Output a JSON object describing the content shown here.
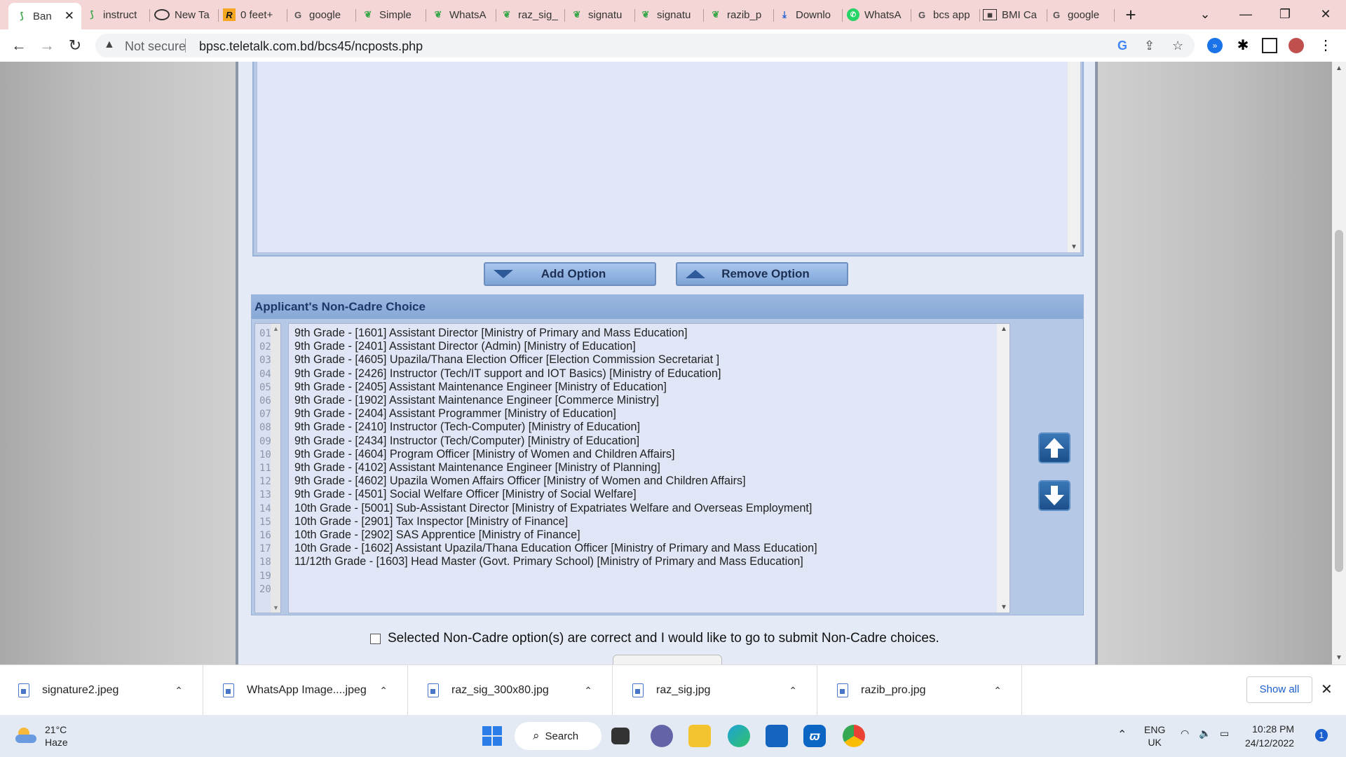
{
  "browser": {
    "tabs": [
      {
        "label": "Ban",
        "icon": "bpsc-leaf-icon",
        "active": true
      },
      {
        "label": "instruct",
        "icon": "bpsc-leaf-icon"
      },
      {
        "label": "New Ta",
        "icon": "chrome-icon"
      },
      {
        "label": "0 feet+",
        "icon": "r-logo-icon"
      },
      {
        "label": "google",
        "icon": "google-icon"
      },
      {
        "label": "Simple",
        "icon": "green-leaf-icon"
      },
      {
        "label": "WhatsA",
        "icon": "green-leaf-icon"
      },
      {
        "label": "raz_sig_",
        "icon": "green-leaf-icon"
      },
      {
        "label": "signatu",
        "icon": "green-leaf-icon"
      },
      {
        "label": "signatu",
        "icon": "green-leaf-icon"
      },
      {
        "label": "razib_p",
        "icon": "green-leaf-icon"
      },
      {
        "label": "Downlo",
        "icon": "download-icon"
      },
      {
        "label": "WhatsA",
        "icon": "whatsapp-icon"
      },
      {
        "label": "bcs app",
        "icon": "google-icon"
      },
      {
        "label": "BMI Ca",
        "icon": "calculator-icon"
      },
      {
        "label": "google",
        "icon": "google-icon"
      }
    ],
    "new_tab": "+",
    "address": {
      "security_label": "Not secure",
      "url": "bpsc.teletalk.com.bd/bcs45/ncposts.php"
    }
  },
  "page": {
    "add_option_label": "Add Option",
    "remove_option_label": "Remove Option",
    "choice_header": "Applicant's Non-Cadre Choice",
    "line_numbers": [
      "01",
      "02",
      "03",
      "04",
      "05",
      "06",
      "07",
      "08",
      "09",
      "10",
      "11",
      "12",
      "13",
      "14",
      "15",
      "16",
      "17",
      "18",
      "19",
      "20"
    ],
    "choices": [
      "9th Grade - [1601] Assistant Director [Ministry of Primary and Mass Education]",
      "9th Grade - [2401] Assistant Director (Admin) [Ministry of Education]",
      "9th Grade - [4605] Upazila/Thana Election Officer [Election Commission Secretariat ]",
      "9th Grade - [2426] Instructor (Tech/IT support and IOT Basics) [Ministry of Education]",
      "9th Grade - [2405] Assistant Maintenance Engineer [Ministry of Education]",
      "9th Grade - [1902] Assistant Maintenance Engineer [Commerce Ministry]",
      "9th Grade - [2404] Assistant Programmer [Ministry of Education]",
      "9th Grade - [2410] Instructor (Tech-Computer) [Ministry of Education]",
      "9th Grade - [2434] Instructor (Tech/Computer) [Ministry of Education]",
      "9th Grade - [4604] Program Officer [Ministry of Women and Children Affairs]",
      "9th Grade - [4102] Assistant Maintenance Engineer [Ministry of Planning]",
      "9th Grade - [4602] Upazila Women Affairs Officer [Ministry of Women and Children Affairs]",
      "9th Grade - [4501] Social Welfare Officer [Ministry of Social Welfare]",
      "10th Grade - [5001] Sub-Assistant Director [Ministry of Expatriates Welfare and Overseas Employment]",
      "10th Grade - [2901] Tax Inspector [Ministry of Finance]",
      "10th Grade - [2902] SAS Apprentice [Ministry of Finance]",
      "10th Grade - [1602] Assistant Upazila/Thana Education Officer [Ministry of Primary and Mass Education]",
      "11/12th Grade - [1603] Head Master (Govt. Primary School) [Ministry of Primary and Mass Education]"
    ],
    "confirm_label": "Selected Non-Cadre option(s) are correct and I would like to go to submit Non-Cadre choices.",
    "confirm_checked": false
  },
  "downloads": {
    "items": [
      "signature2.jpeg",
      "WhatsApp Image....jpeg",
      "raz_sig_300x80.jpg",
      "raz_sig.jpg",
      "razib_pro.jpg"
    ],
    "show_all": "Show all"
  },
  "taskbar": {
    "weather_temp": "21°C",
    "weather_desc": "Haze",
    "search_label": "Search",
    "lang_top": "ENG",
    "lang_bottom": "UK",
    "time": "10:28 PM",
    "date": "24/12/2022",
    "notification_count": "1"
  },
  "colors": {
    "tabstrip": "#f5d6d6",
    "panel_header": "#88a8d6",
    "arrow_button": "#1c4f8a"
  }
}
